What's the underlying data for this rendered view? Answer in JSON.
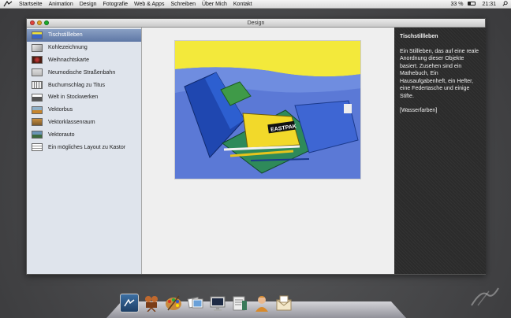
{
  "menubar": {
    "items": [
      "Startseite",
      "Animation",
      "Design",
      "Fotografie",
      "Web & Apps",
      "Schreiben",
      "Über Mich",
      "Kontakt"
    ],
    "battery": "33 %",
    "time": "21:31"
  },
  "window": {
    "title": "Design"
  },
  "sidebar": {
    "items": [
      {
        "label": "Tischstillleben",
        "selected": true
      },
      {
        "label": "Kohlezeichnung"
      },
      {
        "label": "Weihnachtskarte"
      },
      {
        "label": "Neumodische Straßenbahn"
      },
      {
        "label": "Buchumschlag zu Titus"
      },
      {
        "label": "Welt in Stockwerken"
      },
      {
        "label": "Vektorbus"
      },
      {
        "label": "Vektorklassenraum"
      },
      {
        "label": "Vektorauto"
      },
      {
        "label": "Ein mögliches Layout zu Kastor"
      }
    ]
  },
  "artwork": {
    "pencil_case_text": "EASTPAK"
  },
  "detail": {
    "title": "Tischstillleben",
    "description": "Ein Stillleben, das auf eine reale Anordnung dieser Objekte basiert. Zusehen sind ein Mathebuch, Ein Hausaufgabenheft, ein Hefter, eine Federtasche und einige Stifte.",
    "medium": "[Wasserfarben]"
  },
  "dock": {
    "icons": [
      "design-app-icon",
      "film-camera-icon",
      "palette-icon",
      "photos-icon",
      "monitor-icon",
      "writing-icon",
      "person-icon",
      "mail-icon"
    ]
  }
}
